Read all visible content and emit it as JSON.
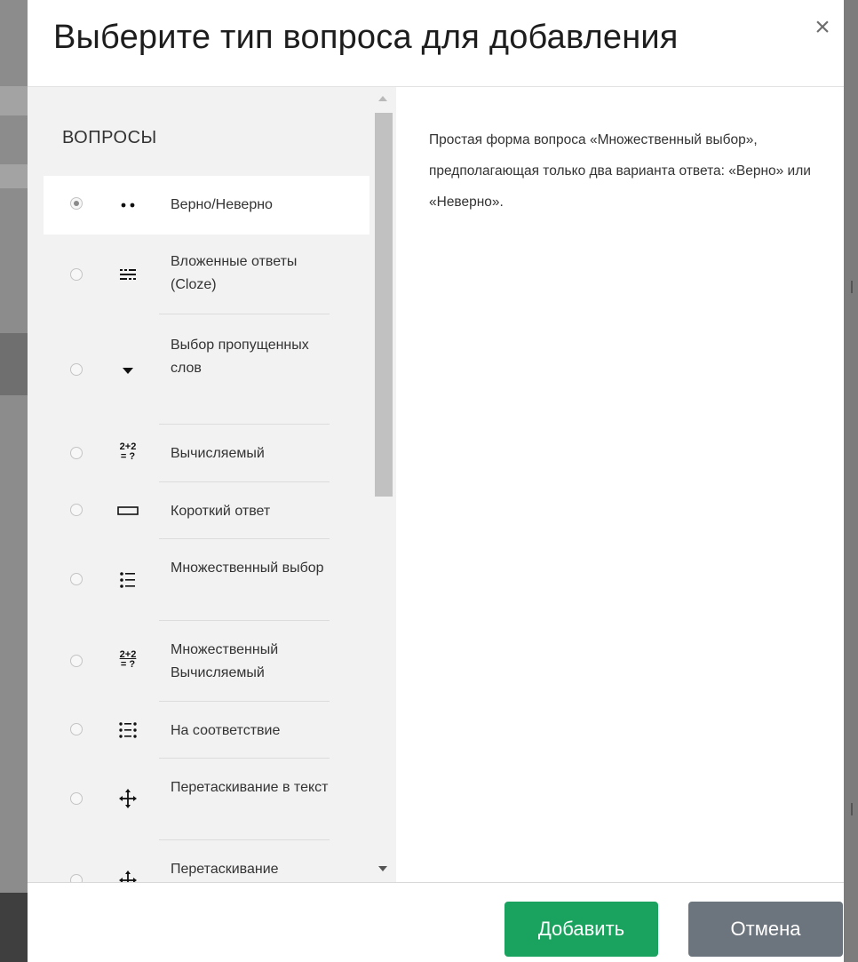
{
  "modal": {
    "title": "Выберите тип вопроса для добавления",
    "close_label": "×"
  },
  "question_list": {
    "section_title": "ВОПРОСЫ",
    "selected_index": 0,
    "items": [
      {
        "label": "Верно/Неверно",
        "icon": "true-false-icon",
        "selected": true
      },
      {
        "label": "Вложенные ответы (Cloze)",
        "icon": "cloze-icon",
        "selected": false
      },
      {
        "label": "Выбор пропущенных слов",
        "icon": "dropdown-arrow-icon",
        "selected": false
      },
      {
        "label": "Вычисляемый",
        "icon": "calculated-icon",
        "selected": false
      },
      {
        "label": "Короткий ответ",
        "icon": "short-answer-icon",
        "selected": false
      },
      {
        "label": "Множественный выбор",
        "icon": "multiple-choice-icon",
        "selected": false
      },
      {
        "label": "Множественный Вычисляемый",
        "icon": "calculated-multi-icon",
        "selected": false
      },
      {
        "label": "На соответствие",
        "icon": "matching-icon",
        "selected": false
      },
      {
        "label": "Перетаскивание в текст",
        "icon": "drag-drop-icon",
        "selected": false
      },
      {
        "label": "Перетаскивание",
        "icon": "drag-drop-icon",
        "selected": false
      }
    ],
    "icon_glyphs": {
      "calculated": [
        "2+2",
        "= ?"
      ],
      "calculated_multi": [
        "2+2",
        "= ?"
      ]
    }
  },
  "description": {
    "text": "Простая форма вопроса «Множественный выбор», предполагающая только два варианта ответа: «Верно» или «Неверно»."
  },
  "footer": {
    "add_label": "Добавить",
    "cancel_label": "Отмена"
  },
  "colors": {
    "add_button": "#1aa35e",
    "cancel_button": "#6c757d",
    "list_background": "#f2f2f2"
  }
}
